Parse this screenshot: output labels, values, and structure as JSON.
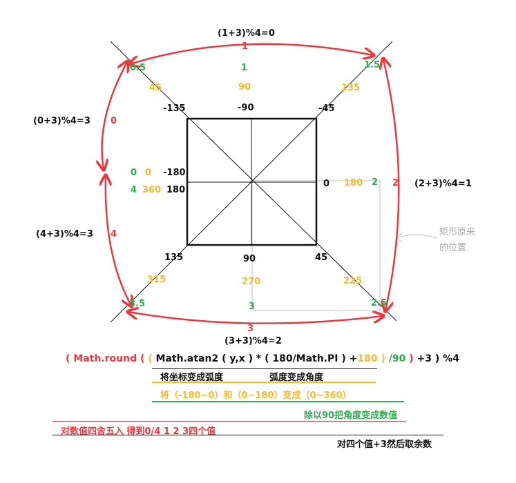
{
  "colors": {
    "red": "#e8383d",
    "green": "#2fa84f",
    "orange": "#f5b92a",
    "black": "#111111",
    "gray": "#a8a8a8"
  },
  "edges": {
    "top": {
      "expr": "(1+3)%4=0",
      "index": "1"
    },
    "left_top": {
      "expr": "(0+3)%4=3",
      "index": "0"
    },
    "left_bottom": {
      "expr": "(4+3)%4=3",
      "index": "4"
    },
    "right": {
      "expr": "(2+3)%4=1",
      "index": "2"
    },
    "bottom": {
      "expr": "(3+3)%4=2",
      "index": "3"
    }
  },
  "values": {
    "corner_tl_green": "0.5",
    "corner_tr_green": "1.5",
    "corner_bl_green": "3.5",
    "corner_br_green": "2.5",
    "top_green": "1",
    "top_orange": "90",
    "top_black": "-90",
    "tl_orange": "45",
    "tl_black": "-135",
    "tr_orange": "135",
    "tr_black": "-45",
    "left_green_top": "0",
    "left_orange_top": "0",
    "left_black_top": "-180",
    "left_green_bottom": "4",
    "left_orange_bottom": "360",
    "left_black_bottom": "180",
    "right_black": "0",
    "right_orange": "180",
    "right_green": "2",
    "bl_black": "135",
    "bl_orange": "315",
    "bottom_black": "90",
    "bottom_orange": "270",
    "bottom_green": "3",
    "br_black": "45",
    "br_orange": "225"
  },
  "annotation": {
    "line1": "矩形原来",
    "line2": "的位置"
  },
  "formula": {
    "p1": "( ",
    "p2": "Math.round (",
    "p3": " (",
    "p4": " Math.atan2 ( y,x ) * ( 180/Math.PI )",
    "p5": " +",
    "p6": "180",
    "p7": " )",
    "p8": " /90",
    "p9": " )",
    "p10": " +3 ) %4"
  },
  "notes": {
    "coord_to_radian": "将坐标变成弧度",
    "radian_to_degree": "弧度变成角度",
    "range_convert": "将（-180~0）和（0~180）变成（0~360）",
    "divide_90": "除以90把角度变成数值",
    "round": "对数值四舍五入 得到0/4  1  2  3四个值",
    "mod": "对四个值+3然后取余数"
  }
}
